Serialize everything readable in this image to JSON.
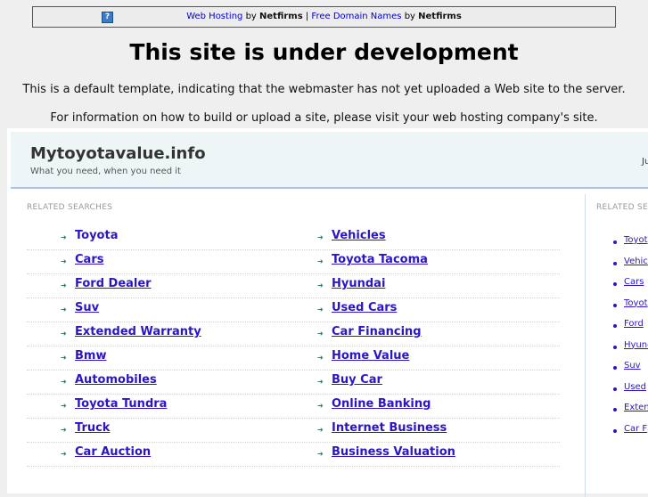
{
  "banner": {
    "link1": "Web Hosting",
    "by1": " by ",
    "brand1": "Netfirms",
    "sep": " | ",
    "link2": "Free Domain Names",
    "by2": " by ",
    "brand2": "Netfirms"
  },
  "title": "This site is under development",
  "para1": "This is a default template, indicating that the webmaster has not yet uploaded a Web site to the server.",
  "para2": "For information on how to build or upload a site, please visit your web hosting company's site.",
  "site": {
    "name": "Mytoyotavalue.info",
    "tagline": "What you need, when you need it",
    "right_text": "Ju"
  },
  "related_label": "RELATED SEARCHES",
  "left_col": [
    "Toyota",
    "Cars",
    "Ford Dealer",
    "Suv",
    "Extended Warranty",
    "Bmw",
    "Automobiles",
    "Toyota Tundra",
    "Truck",
    "Car Auction"
  ],
  "right_col": [
    "Vehicles",
    "Toyota Tacoma",
    "Hyundai",
    "Used Cars",
    "Car Financing",
    "Home Value",
    "Buy Car",
    "Online Banking",
    "Internet Business",
    "Business Valuation"
  ],
  "side_label": "RELATED SEA",
  "side_items": [
    "Toyot",
    "Vehic",
    "Cars",
    "Toyot",
    "Ford",
    "Hyund",
    "Suv",
    "Used",
    "Exten",
    "Car F"
  ]
}
